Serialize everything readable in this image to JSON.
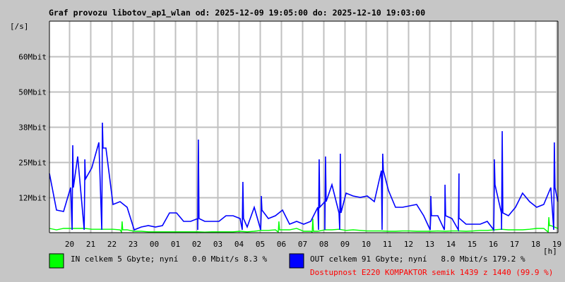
{
  "chart_data": {
    "type": "line",
    "title": "Graf provozu libotov_ap1_wlan od: 2025-12-09 19:05:00 do: 2025-12-10 19:03:00",
    "ylabel": "[/s]",
    "xlabel": "[h]",
    "ylim": [
      0,
      75
    ],
    "xlim_hours": [
      0,
      24
    ],
    "grid": true,
    "y_ticks": [
      {
        "value": 12.5,
        "label": "12Mbit"
      },
      {
        "value": 25,
        "label": "25Mbit"
      },
      {
        "value": 37.5,
        "label": "38Mbit"
      },
      {
        "value": 50,
        "label": "50Mbit"
      },
      {
        "value": 62.5,
        "label": "60Mbit"
      }
    ],
    "x_ticks": [
      "20",
      "21",
      "22",
      "23",
      "00",
      "01",
      "02",
      "03",
      "04",
      "05",
      "06",
      "07",
      "08",
      "09",
      "10",
      "11",
      "12",
      "13",
      "14",
      "15",
      "16",
      "17",
      "18",
      "19"
    ],
    "first_tick_offset_hours": 0.9167,
    "sample_step_hours": 0.3333,
    "series": [
      {
        "name": "IN",
        "color": "#00ff00",
        "values": [
          1.5,
          1,
          1.5,
          1.5,
          1.5,
          1.5,
          1.2,
          1.2,
          1.2,
          1.2,
          1,
          1,
          0.5,
          0.5,
          0.3,
          0.3,
          0.3,
          0.3,
          0.3,
          0.3,
          0.3,
          0.3,
          0.2,
          0.3,
          0.3,
          0.3,
          0.3,
          0.5,
          0.3,
          0.5,
          0.8,
          0.8,
          1,
          1,
          1,
          1.5,
          0.5,
          0.5,
          0.5,
          1,
          1,
          1.2,
          0.8,
          1,
          0.8,
          0.6,
          0.6,
          0.6,
          0.5,
          0.5,
          0.6,
          0.6,
          0.5,
          0.5,
          0.5,
          0.6,
          0.5,
          0.6,
          0.6,
          0.5,
          0.6,
          0.8,
          0.8,
          1,
          1.2,
          1,
          1,
          1,
          1.2,
          1.5,
          1.5,
          2.5,
          1.5
        ],
        "spikes": [
          [
            3.43,
            4
          ],
          [
            10.83,
            4
          ],
          [
            12.43,
            5
          ],
          [
            23.57,
            5.5
          ]
        ]
      },
      {
        "name": "OUT",
        "color": "#0000ff",
        "values": [
          21,
          8,
          7.5,
          16,
          27,
          19,
          23,
          32,
          30,
          10,
          11,
          9,
          1,
          2,
          2.5,
          2,
          2.5,
          7,
          7,
          4,
          4,
          5,
          4,
          4,
          4,
          6,
          6,
          5,
          2,
          9,
          8,
          5,
          6,
          8,
          3,
          4,
          3,
          4,
          9,
          11,
          17,
          7,
          14,
          13,
          12.5,
          13,
          11,
          22,
          15,
          9,
          9,
          9.5,
          10,
          6,
          6,
          6,
          6,
          5,
          5,
          3,
          3,
          3,
          4,
          17,
          7,
          6,
          9,
          14,
          11,
          9,
          10,
          16,
          11
        ],
        "spikes": [
          [
            1.1,
            31
          ],
          [
            1.67,
            26
          ],
          [
            2.5,
            39
          ],
          [
            7.03,
            33
          ],
          [
            9.13,
            18
          ],
          [
            10.0,
            13
          ],
          [
            12.73,
            26
          ],
          [
            13.03,
            27
          ],
          [
            13.73,
            28
          ],
          [
            15.73,
            28
          ],
          [
            18.0,
            13
          ],
          [
            18.67,
            17
          ],
          [
            19.33,
            21
          ],
          [
            21.0,
            26
          ],
          [
            21.37,
            36
          ],
          [
            23.83,
            32
          ]
        ]
      }
    ]
  },
  "legend": {
    "in_text": "IN celkem 5 Gbyte; nyní   0.0 Mbit/s 8.3 %",
    "out_text": "OUT celkem 91 Gbyte; nyní   8.0 Mbit/s 179.2 %",
    "availability": "Dostupnost E220 KOMPAKTOR semik 1439 z 1440 (99.9 %)",
    "in_color": "#00ff00",
    "out_color": "#0000ff"
  }
}
